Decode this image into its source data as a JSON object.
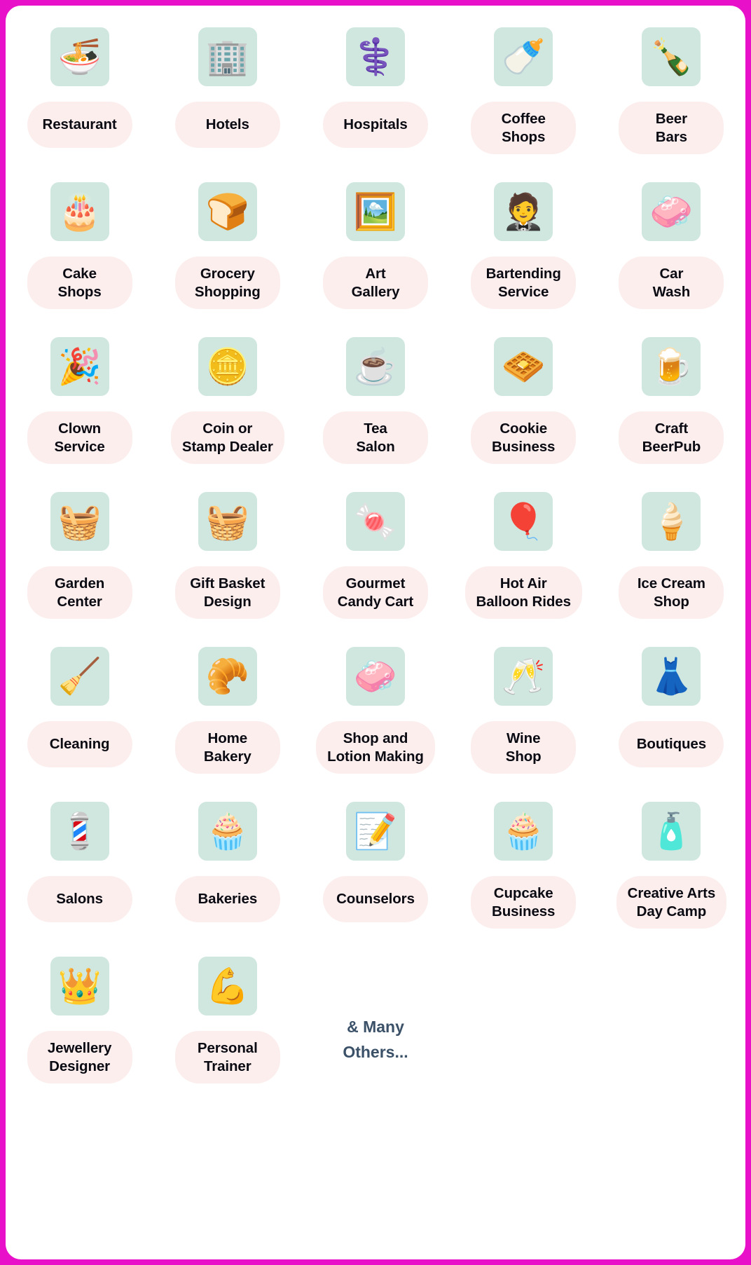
{
  "page": {
    "border_color": "#e810c8",
    "card_background": "#ffffff",
    "tile_color": "#cfe7df",
    "pill_color": "#fdeeee",
    "label_color": "#0a0a12",
    "note_color": "#3b5168"
  },
  "grid": {
    "columns": 5,
    "rows": 8,
    "items": [
      {
        "label": "Restaurant",
        "icon": "noodle-bowl-icon",
        "glyph": "🍜"
      },
      {
        "label": "Hotels",
        "icon": "office-buildings-icon",
        "glyph": "🏢"
      },
      {
        "label": "Hospitals",
        "icon": "caduceus-icon",
        "glyph": "⚕️"
      },
      {
        "label": "Coffee\nShops",
        "icon": "coffee-mug-icon",
        "glyph": "🍼"
      },
      {
        "label": "Beer\nBars",
        "icon": "beer-bottles-icon",
        "glyph": "🍾"
      },
      {
        "label": "Cake\nShops",
        "icon": "birthday-cake-icon",
        "glyph": "🎂"
      },
      {
        "label": "Grocery\nShopping",
        "icon": "bread-loaf-icon",
        "glyph": "🍞"
      },
      {
        "label": "Art\nGallery",
        "icon": "framed-picture-icon",
        "glyph": "🖼️"
      },
      {
        "label": "Bartending\nService",
        "icon": "bartender-person-icon",
        "glyph": "🤵"
      },
      {
        "label": "Car\nWash",
        "icon": "sparkling-glass-icon",
        "glyph": "🧼"
      },
      {
        "label": "Clown\nService",
        "icon": "party-popper-icon",
        "glyph": "🎉"
      },
      {
        "label": "Coin or\nStamp Dealer",
        "icon": "gold-coins-icon",
        "glyph": "🪙"
      },
      {
        "label": "Tea\nSalon",
        "icon": "teacup-icon",
        "glyph": "☕"
      },
      {
        "label": "Cookie\nBusiness",
        "icon": "cracker-biscuits-icon",
        "glyph": "🧇"
      },
      {
        "label": "Craft\nBeerPub",
        "icon": "beer-mug-icon",
        "glyph": "🍺"
      },
      {
        "label": "Garden\nCenter",
        "icon": "wheelbarrow-icon",
        "glyph": "🧺"
      },
      {
        "label": "Gift Basket\nDesign",
        "icon": "gift-basket-icon",
        "glyph": "🧺"
      },
      {
        "label": "Gourmet\nCandy Cart",
        "icon": "wrapped-candy-icon",
        "glyph": "🍬"
      },
      {
        "label": "Hot Air\nBalloon Rides",
        "icon": "hot-air-balloon-icon",
        "glyph": "🎈"
      },
      {
        "label": "Ice Cream\nShop",
        "icon": "ice-cream-cone-icon",
        "glyph": "🍦"
      },
      {
        "label": "Cleaning",
        "icon": "vacuum-cleaner-icon",
        "glyph": "🧹"
      },
      {
        "label": "Home\nBakery",
        "icon": "rolling-pin-dough-icon",
        "glyph": "🥐"
      },
      {
        "label": "Shop and\nLotion Making",
        "icon": "soap-bars-icon",
        "glyph": "🧼"
      },
      {
        "label": "Wine\nShop",
        "icon": "clinking-glasses-icon",
        "glyph": "🥂"
      },
      {
        "label": "Boutiques",
        "icon": "red-dress-icon",
        "glyph": "👗"
      },
      {
        "label": "Salons",
        "icon": "barber-pole-icon",
        "glyph": "💈"
      },
      {
        "label": "Bakeries",
        "icon": "cupcake-icon",
        "glyph": "🧁"
      },
      {
        "label": "Counselors",
        "icon": "notepad-pen-icon",
        "glyph": "📝"
      },
      {
        "label": "Cupcake\nBusiness",
        "icon": "frosted-cupcake-icon",
        "glyph": "🧁"
      },
      {
        "label": "Creative Arts\nDay Camp",
        "icon": "spray-paint-icon",
        "glyph": "🧴"
      },
      {
        "label": "Jewellery\nDesigner",
        "icon": "crown-sparkle-icon",
        "glyph": "👑"
      },
      {
        "label": "Personal\nTrainer",
        "icon": "flexed-biceps-icon",
        "glyph": "💪"
      }
    ],
    "note": "& Many\nOthers..."
  }
}
